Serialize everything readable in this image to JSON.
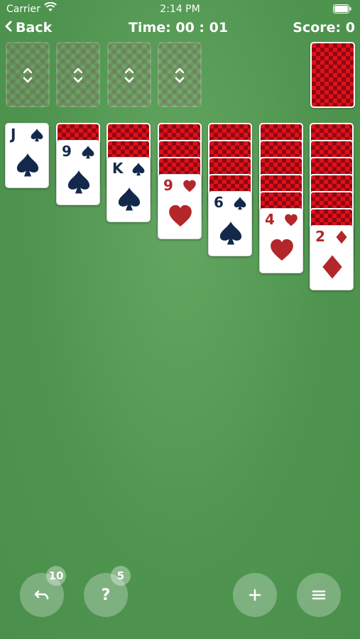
{
  "status_bar": {
    "carrier": "Carrier",
    "time": "2:14 PM"
  },
  "header": {
    "back_label": "Back",
    "timer": "Time: 00 : 01",
    "score": "Score: 0"
  },
  "foundations": {
    "count": 4,
    "icon": "up-down-arrows-icon"
  },
  "stock": {
    "state": "face-down"
  },
  "tableau": [
    {
      "hidden": 0,
      "top_card": {
        "rank": "J",
        "suit": "spades",
        "color": "#13294b"
      }
    },
    {
      "hidden": 1,
      "top_card": {
        "rank": "9",
        "suit": "spades",
        "color": "#13294b"
      }
    },
    {
      "hidden": 2,
      "top_card": {
        "rank": "K",
        "suit": "spades",
        "color": "#13294b"
      }
    },
    {
      "hidden": 3,
      "top_card": {
        "rank": "9",
        "suit": "hearts",
        "color": "#b3262a"
      }
    },
    {
      "hidden": 4,
      "top_card": {
        "rank": "6",
        "suit": "spades",
        "color": "#13294b"
      }
    },
    {
      "hidden": 5,
      "top_card": {
        "rank": "4",
        "suit": "hearts",
        "color": "#b3262a"
      }
    },
    {
      "hidden": 6,
      "top_card": {
        "rank": "2",
        "suit": "diamonds",
        "color": "#b3262a"
      }
    }
  ],
  "controls": {
    "undo": {
      "icon": "undo-icon",
      "badge": "10"
    },
    "hint": {
      "icon": "question-icon",
      "label": "?",
      "badge": "5"
    },
    "new_game": {
      "icon": "plus-icon"
    },
    "menu": {
      "icon": "menu-icon"
    }
  },
  "colors": {
    "felt": "#4f9550",
    "card_back": "#e0101a",
    "black_suit": "#13294b",
    "red_suit": "#b3262a"
  }
}
